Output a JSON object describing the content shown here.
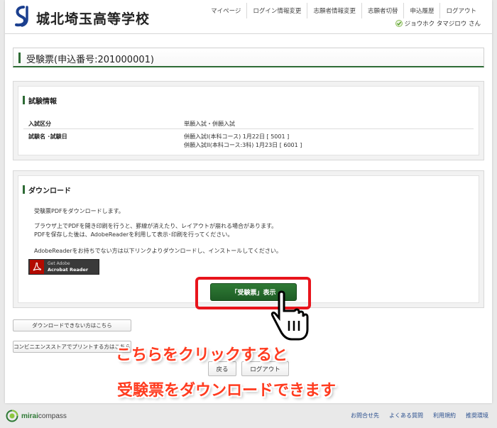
{
  "header": {
    "school_name": "城北埼玉高等学校",
    "nav": [
      "マイページ",
      "ログイン情報変更",
      "志願者情報変更",
      "志願者切替",
      "申込履歴",
      "ログアウト"
    ],
    "user_name": "ジョウホク タマジロウ さん"
  },
  "page_title": "受験票(申込番号:201000001)",
  "exam_info": {
    "heading": "試験情報",
    "rows": [
      {
        "label": "入試区分",
        "value": "単願入試・併願入試"
      },
      {
        "label": "試験名 ･試験日",
        "value": "併願入試I(本科コース)  1月22日    [ 5001 ]",
        "value2": "併願入試II(本科コース:3科)  1月23日    [ 6001 ]"
      }
    ]
  },
  "download": {
    "heading": "ダウンロード",
    "lines": [
      "受験票PDFをダウンロードします。",
      "ブラウザ上でPDFを開き印刷を行うと、罫線が消えたり、レイアウトが崩れる場合があります。",
      "PDFを保存した後は、AdobeReaderを利用して表示･印刷を行ってください。",
      "AdobeReaderをお持ちでない方は以下リンクよりダウンロードし、インストールしてください。"
    ],
    "acrobat_line1": "Get Adobe",
    "acrobat_line2": "Acrobat Reader",
    "button_label": "「受験票」表示"
  },
  "help_buttons": {
    "cannot_download": "ダウンロードできない方はこちら",
    "convenience_store": "コンビニエンスストアでプリントする方はこちら"
  },
  "overlay": {
    "line1": "こちらをクリックすると",
    "line2": "受験票をダウンロードできます"
  },
  "bottom_nav": {
    "back": "戻る",
    "logout": "ログアウト"
  },
  "footer": {
    "brand_prefix": "mirai",
    "brand_suffix": "compass",
    "links": [
      "お問合せ先",
      "よくある質問",
      "利用規約",
      "推奨環境"
    ]
  },
  "colors": {
    "brand_green": "#2e6b35",
    "highlight_red": "#e8141c",
    "overlay_text": "#ff3b1f",
    "link_blue": "#2a4f8e"
  }
}
